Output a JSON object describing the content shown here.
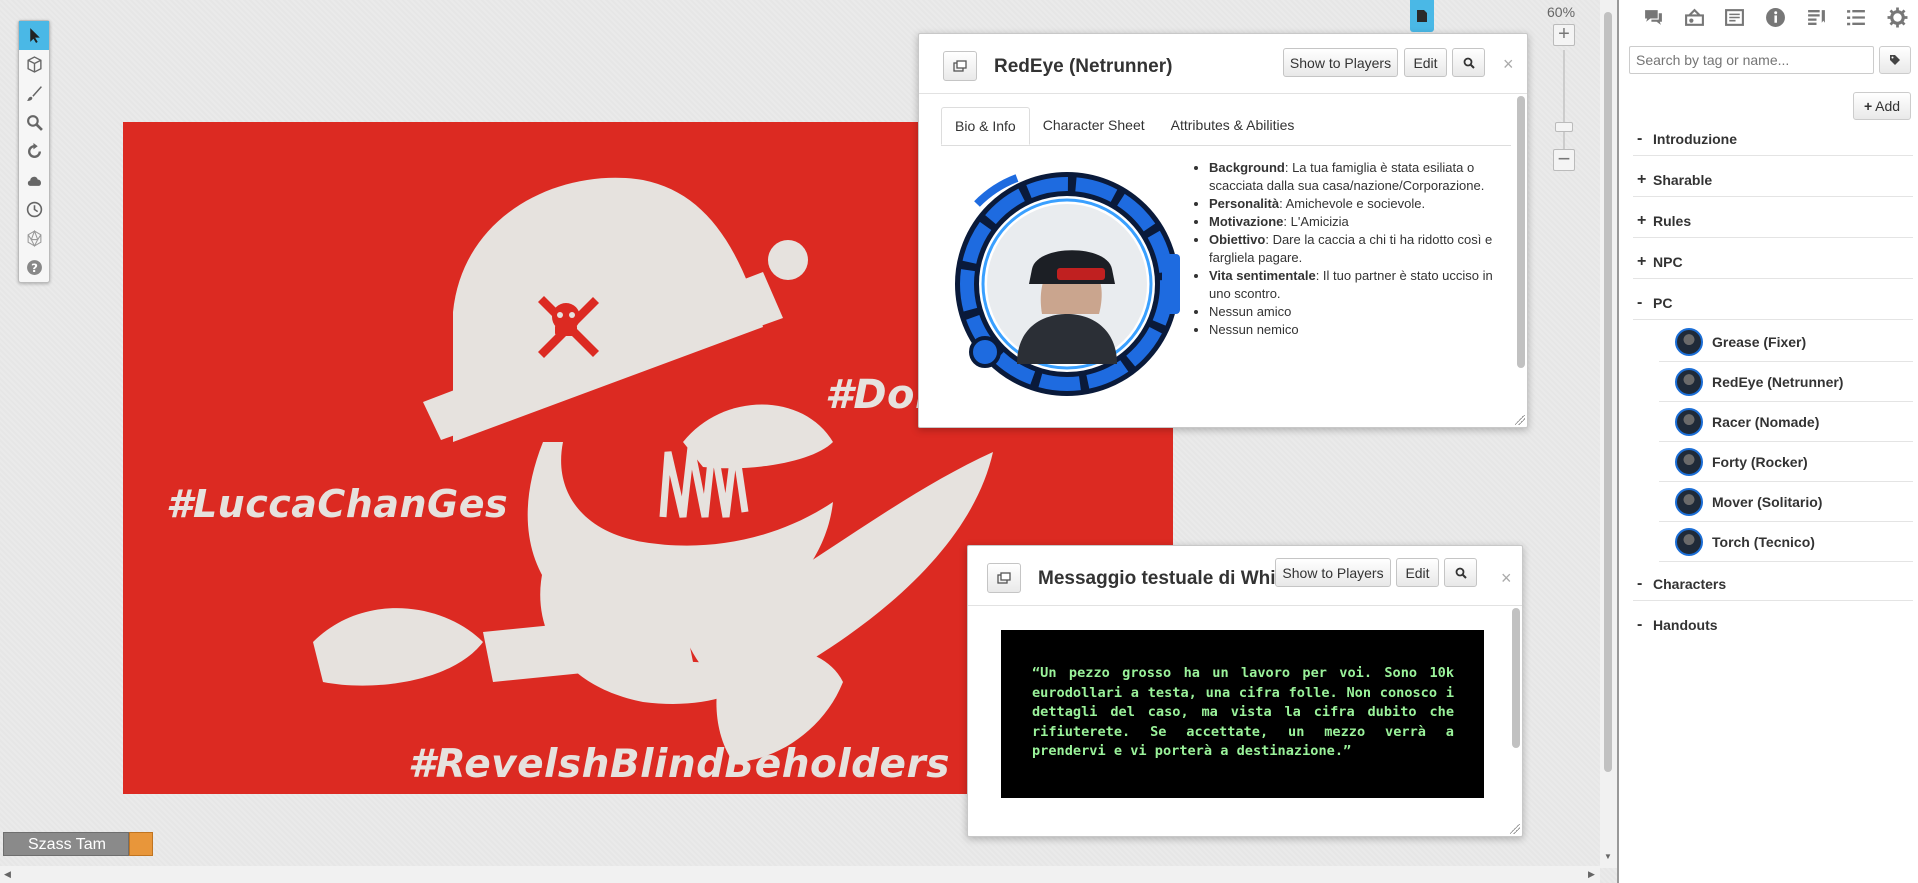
{
  "toolbar": {
    "tools": [
      "select-icon",
      "cube-icon",
      "brush-icon",
      "zoom-icon",
      "refresh-icon",
      "cloud-icon",
      "clock-icon",
      "dice-icon",
      "help-icon"
    ]
  },
  "zoom": {
    "label": "60%"
  },
  "map": {
    "hashtags": [
      "#LuccaChanGes",
      "#Don",
      "#RevelshBlindBeholders"
    ],
    "colors": {
      "background": "#dc2a22",
      "figure": "#e6e2de"
    }
  },
  "player": {
    "name": "Szass Tam",
    "color": "#e8963a"
  },
  "bio_dialog": {
    "title": "RedEye (Netrunner)",
    "show_button": "Show to Players",
    "edit_button": "Edit",
    "close": "×",
    "tabs": [
      "Bio & Info",
      "Character Sheet",
      "Attributes & Abilities"
    ],
    "bio": [
      {
        "label": "Background",
        "text": ": La tua famiglia è stata esiliata o scacciata dalla sua casa/nazione/Corporazione."
      },
      {
        "label": "Personalità",
        "text": ": Amichevole e socievole."
      },
      {
        "label": "Motivazione",
        "text": ": L'Amicizia"
      },
      {
        "label": "Obiettivo",
        "text": ": Dare la caccia a chi ti ha ridotto così e fargliela pagare."
      },
      {
        "label": "Vita sentimentale",
        "text": ": Il tuo partner è stato ucciso in uno scontro."
      },
      {
        "label": "",
        "text": "Nessun amico"
      },
      {
        "label": "",
        "text": "Nessun nemico"
      }
    ]
  },
  "msg_dialog": {
    "title": "Messaggio testuale di White",
    "show_button": "Show to Players",
    "edit_button": "Edit",
    "close": "×",
    "message": "“Un pezzo grosso ha un lavoro per voi. Sono 10k eurodollari a testa, una cifra folle. Non conosco i dettagli del caso, ma vista la cifra dubito che rifiuterete. Se accettate, un mezzo verrà a prendervi e vi porterà a destinazione.”"
  },
  "panel": {
    "icons": [
      "chat-icon",
      "jukebox-icon",
      "journal-icon",
      "info-icon",
      "compendium-icon",
      "list-icon",
      "settings-icon"
    ],
    "search_placeholder": "Search by tag or name...",
    "add_button": "Add",
    "folders": [
      {
        "sign": "-",
        "name": "Introduzione"
      },
      {
        "sign": "+",
        "name": "Sharable"
      },
      {
        "sign": "+",
        "name": "Rules"
      },
      {
        "sign": "+",
        "name": "NPC"
      },
      {
        "sign": "-",
        "name": "PC"
      }
    ],
    "characters": [
      "Grease (Fixer)",
      "RedEye (Netrunner)",
      "Racer (Nomade)",
      "Forty (Rocker)",
      "Mover (Solitario)",
      "Torch (Tecnico)"
    ],
    "bottom_folders": [
      {
        "sign": "-",
        "name": "Characters"
      },
      {
        "sign": "-",
        "name": "Handouts"
      }
    ]
  }
}
